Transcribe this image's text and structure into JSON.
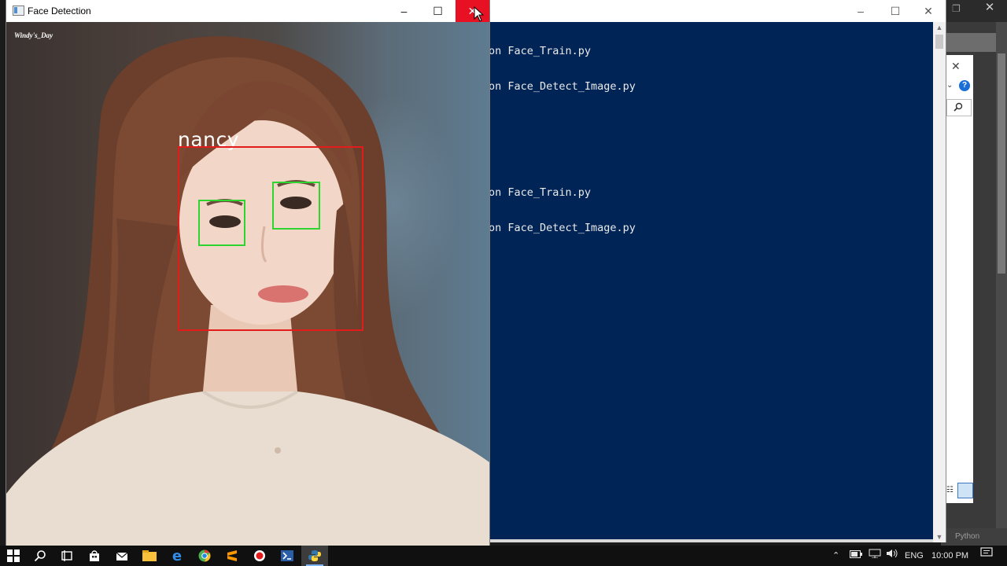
{
  "face_window": {
    "title": "Face Detection",
    "minimize": "–",
    "maximize": "☐",
    "close": "✕",
    "watermark": "Windy's_Day",
    "detection": {
      "label": "nancy",
      "face_box_color": "#e21b1b",
      "eye_box_color": "#30d430"
    }
  },
  "console_window": {
    "minimize": "–",
    "maximize": "☐",
    "close": "✕",
    "lines": [
      "on Face_Train.py",
      "on Face_Detect_Image.py",
      "",
      "",
      "on Face_Train.py",
      "on Face_Detect_Image.py"
    ],
    "background": "#012456"
  },
  "background_window": {
    "status_text": "Python"
  },
  "taskbar": {
    "apps": [
      "start-icon",
      "search-icon",
      "task-view-icon",
      "store-icon",
      "mail-icon",
      "file-explorer-icon",
      "edge-icon",
      "chrome-icon",
      "sublime-icon",
      "record-icon",
      "powershell-icon",
      "python-icon"
    ],
    "active_app": "python-icon",
    "language": "ENG",
    "time": "10:00 PM"
  }
}
